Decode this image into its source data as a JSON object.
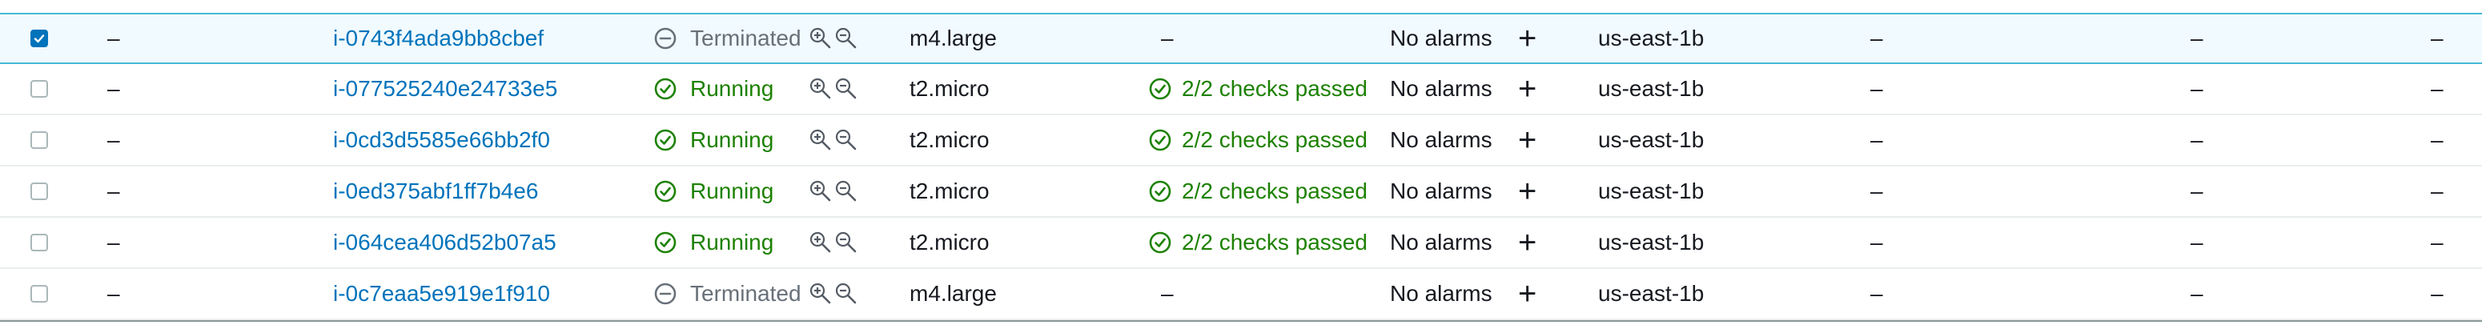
{
  "colors": {
    "link": "#0073bb",
    "running": "#1d8102",
    "terminated": "#687078",
    "selected_bg": "#f1faff",
    "selected_border": "#44b9d6"
  },
  "rows": [
    {
      "selected": true,
      "name": "–",
      "instance_id": "i-0743f4ada9bb8cbef",
      "state": "Terminated",
      "state_icon": "minus-circle-icon",
      "type": "m4.large",
      "status_check": "–",
      "status_icon": "",
      "alarm": "No alarms",
      "az": "us-east-1b",
      "col9": "–",
      "col10": "–",
      "col11": "–"
    },
    {
      "selected": false,
      "name": "–",
      "instance_id": "i-077525240e24733e5",
      "state": "Running",
      "state_icon": "check-circle-icon",
      "type": "t2.micro",
      "status_check": "2/2 checks passed",
      "status_icon": "check-circle-icon",
      "alarm": "No alarms",
      "az": "us-east-1b",
      "col9": "–",
      "col10": "–",
      "col11": "–"
    },
    {
      "selected": false,
      "name": "–",
      "instance_id": "i-0cd3d5585e66bb2f0",
      "state": "Running",
      "state_icon": "check-circle-icon",
      "type": "t2.micro",
      "status_check": "2/2 checks passed",
      "status_icon": "check-circle-icon",
      "alarm": "No alarms",
      "az": "us-east-1b",
      "col9": "–",
      "col10": "–",
      "col11": "–"
    },
    {
      "selected": false,
      "name": "–",
      "instance_id": "i-0ed375abf1ff7b4e6",
      "state": "Running",
      "state_icon": "check-circle-icon",
      "type": "t2.micro",
      "status_check": "2/2 checks passed",
      "status_icon": "check-circle-icon",
      "alarm": "No alarms",
      "az": "us-east-1b",
      "col9": "–",
      "col10": "–",
      "col11": "–"
    },
    {
      "selected": false,
      "name": "–",
      "instance_id": "i-064cea406d52b07a5",
      "state": "Running",
      "state_icon": "check-circle-icon",
      "type": "t2.micro",
      "status_check": "2/2 checks passed",
      "status_icon": "check-circle-icon",
      "alarm": "No alarms",
      "az": "us-east-1b",
      "col9": "–",
      "col10": "–",
      "col11": "–"
    },
    {
      "selected": false,
      "name": "–",
      "instance_id": "i-0c7eaa5e919e1f910",
      "state": "Terminated",
      "state_icon": "minus-circle-icon",
      "type": "m4.large",
      "status_check": "–",
      "status_icon": "",
      "alarm": "No alarms",
      "az": "us-east-1b",
      "col9": "–",
      "col10": "–",
      "col11": "–"
    }
  ]
}
